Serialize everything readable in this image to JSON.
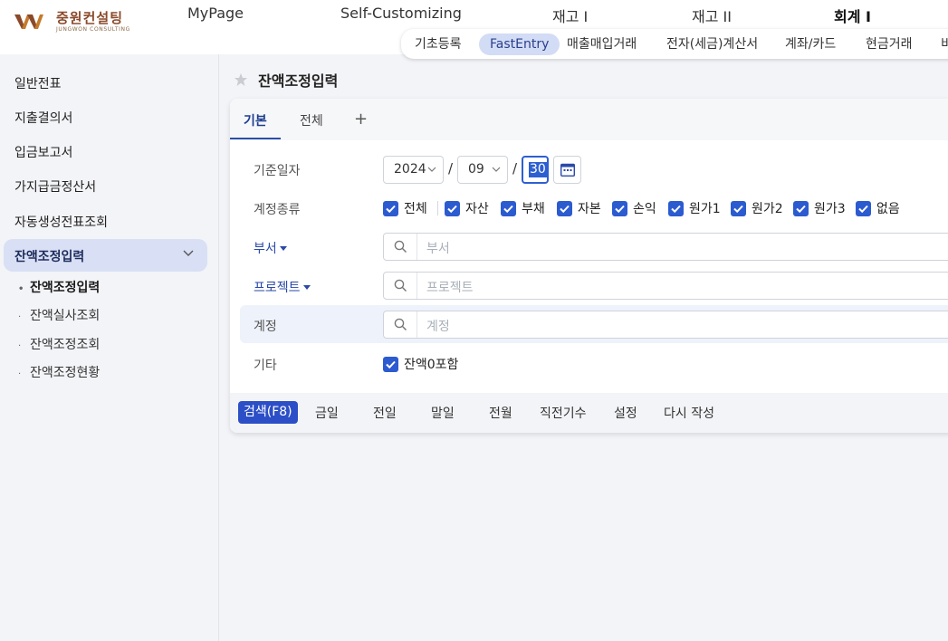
{
  "logo": {
    "kr": "중원컨설팅",
    "en": "JUNGWON CONSULTING"
  },
  "topnav": [
    "MyPage",
    "Self-Customizing",
    "재고 I",
    "재고 II",
    "회계 I"
  ],
  "subnav": [
    "기초등록",
    "FastEntry",
    "매출매입거래",
    "전자(세금)계산서",
    "계좌/카드",
    "현금거래",
    "비"
  ],
  "sidebar": {
    "items": [
      "일반전표",
      "지출결의서",
      "입금보고서",
      "가지급금정산서",
      "자동생성전표조회",
      "잔액조정입력"
    ],
    "subitems": [
      "잔액조정입력",
      "잔액실사조회",
      "잔액조정조회",
      "잔액조정현황"
    ]
  },
  "page": {
    "title": "잔액조정입력"
  },
  "tabs": [
    "기본",
    "전체",
    "+"
  ],
  "form": {
    "date_label": "기준일자",
    "year": "2024",
    "month": "09",
    "day": "30",
    "date_sep": "/",
    "type_label": "계정종류",
    "types": [
      "전체",
      "자산",
      "부채",
      "자본",
      "손익",
      "원가1",
      "원가2",
      "원가3",
      "없음"
    ],
    "dept_label": "부서",
    "dept_placeholder": "부서",
    "project_label": "프로젝트",
    "project_placeholder": "프로젝트",
    "account_label": "계정",
    "account_placeholder": "계정",
    "etc_label": "기타",
    "etc_option": "잔액0포함"
  },
  "actions": [
    "검색(F8)",
    "금일",
    "전일",
    "말일",
    "전월",
    "직전기수",
    "설정",
    "다시 작성"
  ],
  "colors": {
    "accent": "#2c5bd0",
    "primary_button": "#2c4fc7",
    "active_side": "#d9e0f5",
    "active_subnav": "#d3dcf5"
  }
}
